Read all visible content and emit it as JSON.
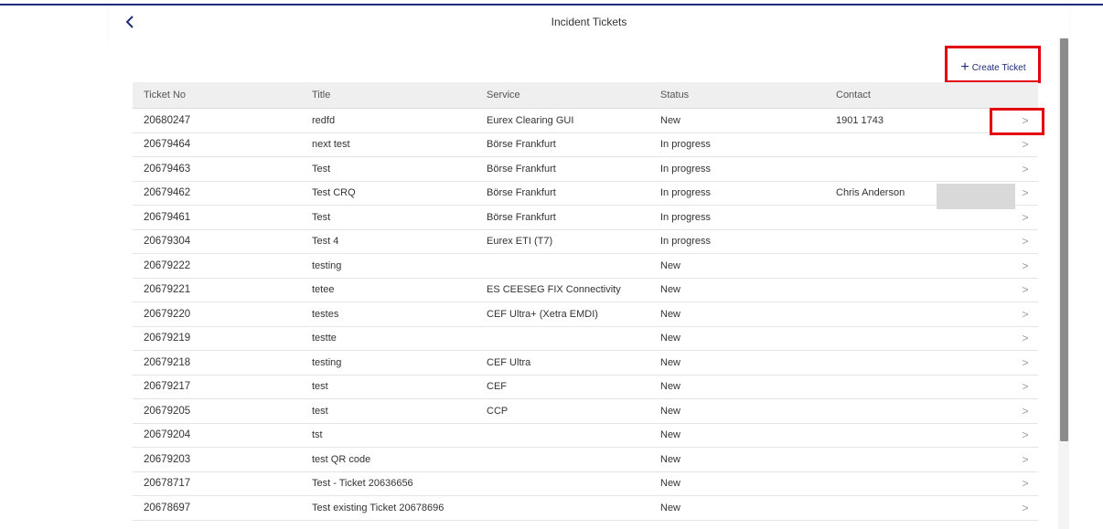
{
  "header": {
    "title": "Incident Tickets",
    "back_icon": "chevron-left-icon"
  },
  "toolbar": {
    "create_label": "Create Ticket",
    "create_icon": "plus-icon"
  },
  "table": {
    "columns": [
      "Ticket No",
      "Title",
      "Service",
      "Status",
      "Contact"
    ],
    "rows": [
      {
        "no": "20680247",
        "title": "redfd",
        "service": "Eurex Clearing GUI",
        "status": "New",
        "contact": "1901 1743"
      },
      {
        "no": "20679464",
        "title": "next test",
        "service": "Börse Frankfurt",
        "status": "In progress",
        "contact": ""
      },
      {
        "no": "20679463",
        "title": "Test",
        "service": "Börse Frankfurt",
        "status": "In progress",
        "contact": ""
      },
      {
        "no": "20679462",
        "title": "Test CRQ",
        "service": "Börse Frankfurt",
        "status": "In progress",
        "contact": "Chris Anderson"
      },
      {
        "no": "20679461",
        "title": "Test",
        "service": "Börse Frankfurt",
        "status": "In progress",
        "contact": ""
      },
      {
        "no": "20679304",
        "title": "Test 4",
        "service": "Eurex ETI (T7)",
        "status": "In progress",
        "contact": ""
      },
      {
        "no": "20679222",
        "title": "testing",
        "service": "",
        "status": "New",
        "contact": ""
      },
      {
        "no": "20679221",
        "title": "tetee",
        "service": "ES CEESEG FIX Connectivity",
        "status": "New",
        "contact": ""
      },
      {
        "no": "20679220",
        "title": "testes",
        "service": "CEF Ultra+ (Xetra EMDI)",
        "status": "New",
        "contact": ""
      },
      {
        "no": "20679219",
        "title": "testte",
        "service": "",
        "status": "New",
        "contact": ""
      },
      {
        "no": "20679218",
        "title": "testing",
        "service": "CEF Ultra",
        "status": "New",
        "contact": ""
      },
      {
        "no": "20679217",
        "title": "test",
        "service": "CEF",
        "status": "New",
        "contact": ""
      },
      {
        "no": "20679205",
        "title": "test",
        "service": "CCP",
        "status": "New",
        "contact": ""
      },
      {
        "no": "20679204",
        "title": "tst",
        "service": "",
        "status": "New",
        "contact": ""
      },
      {
        "no": "20679203",
        "title": "test QR code",
        "service": "",
        "status": "New",
        "contact": ""
      },
      {
        "no": "20678717",
        "title": "Test - Ticket 20636656",
        "service": "",
        "status": "New",
        "contact": ""
      },
      {
        "no": "20678697",
        "title": "Test existing Ticket 20678696",
        "service": "",
        "status": "New",
        "contact": ""
      }
    ],
    "row_chevron_icon": "chevron-right-icon",
    "chevron_glyph": ">"
  },
  "colors": {
    "accent": "#1f2a7a",
    "highlight": "#e3000f",
    "header_row_bg": "#efefef"
  }
}
